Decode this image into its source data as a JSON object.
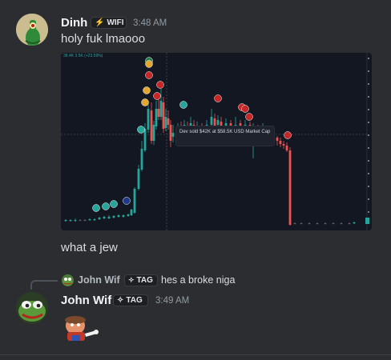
{
  "messages": [
    {
      "username": "Dinh",
      "tag": "WIFI",
      "tag_icon": "lightning-icon",
      "time": "3:48 AM",
      "text": "holy fuk lmaooo",
      "attachment_tooltip": "Dev sold $42K at $58.5K USD Market Cap",
      "attachment_header": "38.4K 3.5K (+23.59%)",
      "followup_text": "what a jew"
    },
    {
      "reply": {
        "username": "John Wif",
        "tag": "TAG",
        "text": "hes a broke niga"
      },
      "username": "John Wif",
      "tag": "TAG",
      "tag_icon": "sparkle-icon",
      "time": "3:49 AM"
    }
  ],
  "colors": {
    "background": "#2b2d31",
    "chart_background": "#131722",
    "candle_up": "#26a69a",
    "candle_down": "#ef5350",
    "username": "#f2f3f5",
    "timestamp": "#949ba4"
  }
}
